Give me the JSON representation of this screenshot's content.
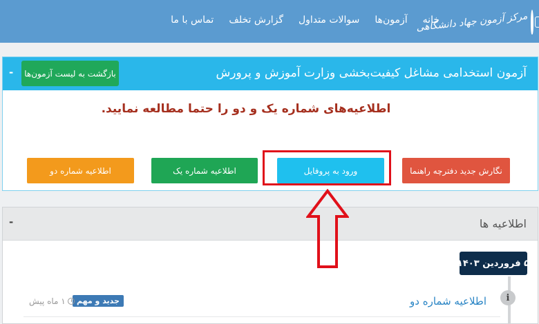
{
  "header": {
    "logo_text": "مرکز آزمون جهاد دانشگاهی",
    "nav": [
      "خانه",
      "آزمون‌ها",
      "سوالات متداول",
      "گزارش تخلف",
      "تماس با ما"
    ]
  },
  "exam": {
    "title": "آزمون استخدامی مشاغل کیفیت‌بخشی وزارت آموزش و پرورش",
    "back_button": "بازگشت به لیست آزمون‌ها",
    "collapse_symbol": "-",
    "notice": "اطلاعیه‌های شماره یک و دو را حتما مطالعه نمایید.",
    "actions": {
      "guide": "نگارش جدید دفترچه راهنما",
      "profile": "ورود به پروفایل",
      "notice_one": "اطلاعیه شماره یک",
      "notice_two": "اطلاعیه شماره دو"
    }
  },
  "announcements": {
    "title": "اطلاعیه ها",
    "collapse_symbol": "-",
    "date": "۵ فروردین ۱۴۰۳",
    "info_symbol": "i",
    "item": {
      "title": "اطلاعیه شماره دو",
      "badge": "جدید و مهم",
      "time_ago": "۱ ماه پیش"
    }
  },
  "colors": {
    "navbar": "#5b9bd0",
    "panel_header": "#2ab7ea",
    "highlight": "#e0101a",
    "notice_text": "#a52f1e"
  }
}
